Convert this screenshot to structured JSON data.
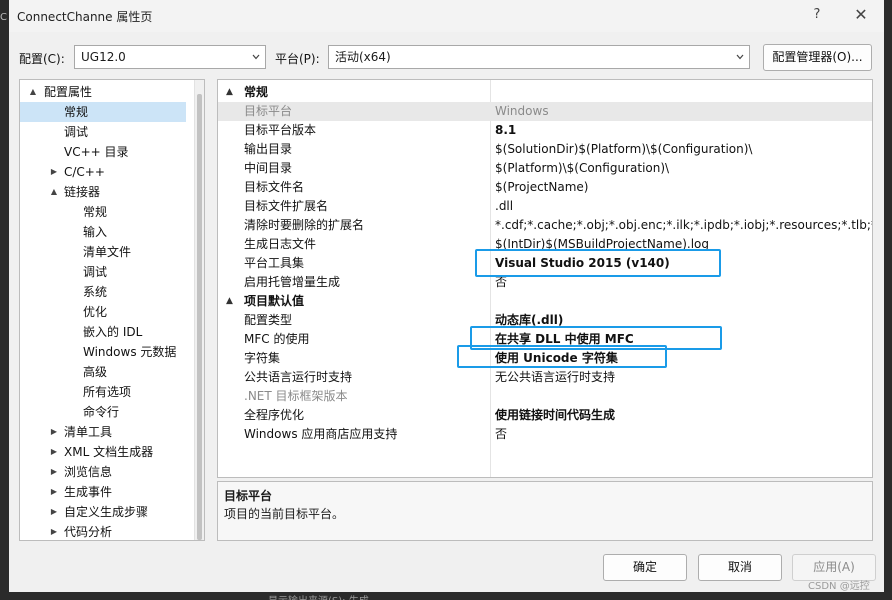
{
  "window": {
    "title": "ConnectChanne 属性页",
    "help_glyph": "?",
    "close_glyph": "✕"
  },
  "toolbar": {
    "config_label": "配置(C):",
    "config_value": "UG12.0",
    "platform_label": "平台(P):",
    "platform_value": "活动(x64)",
    "config_manager_label": "配置管理器(O)..."
  },
  "tree": {
    "items": [
      {
        "label": "配置属性",
        "expand": "▲",
        "depth": 0
      },
      {
        "label": "常规",
        "expand": "",
        "depth": 1,
        "selected": true
      },
      {
        "label": "调试",
        "expand": "",
        "depth": 1
      },
      {
        "label": "VC++ 目录",
        "expand": "",
        "depth": 1
      },
      {
        "label": "C/C++",
        "expand": "▶",
        "depth": 1
      },
      {
        "label": "链接器",
        "expand": "▲",
        "depth": 1
      },
      {
        "label": "常规",
        "expand": "",
        "depth": 2
      },
      {
        "label": "输入",
        "expand": "",
        "depth": 2
      },
      {
        "label": "清单文件",
        "expand": "",
        "depth": 2
      },
      {
        "label": "调试",
        "expand": "",
        "depth": 2
      },
      {
        "label": "系统",
        "expand": "",
        "depth": 2
      },
      {
        "label": "优化",
        "expand": "",
        "depth": 2
      },
      {
        "label": "嵌入的 IDL",
        "expand": "",
        "depth": 2
      },
      {
        "label": "Windows 元数据",
        "expand": "",
        "depth": 2
      },
      {
        "label": "高级",
        "expand": "",
        "depth": 2
      },
      {
        "label": "所有选项",
        "expand": "",
        "depth": 2
      },
      {
        "label": "命令行",
        "expand": "",
        "depth": 2
      },
      {
        "label": "清单工具",
        "expand": "▶",
        "depth": 1
      },
      {
        "label": "XML 文档生成器",
        "expand": "▶",
        "depth": 1
      },
      {
        "label": "浏览信息",
        "expand": "▶",
        "depth": 1
      },
      {
        "label": "生成事件",
        "expand": "▶",
        "depth": 1
      },
      {
        "label": "自定义生成步骤",
        "expand": "▶",
        "depth": 1
      },
      {
        "label": "代码分析",
        "expand": "▶",
        "depth": 1
      }
    ]
  },
  "grid": {
    "sections": [
      {
        "name": "常规",
        "caret": "▲",
        "rows": [
          {
            "name": "目标平台",
            "value": "Windows",
            "disabled": true,
            "selected": true
          },
          {
            "name": "目标平台版本",
            "value": "8.1",
            "bold": true
          },
          {
            "name": "输出目录",
            "value": "$(SolutionDir)$(Platform)\\$(Configuration)\\"
          },
          {
            "name": "中间目录",
            "value": "$(Platform)\\$(Configuration)\\"
          },
          {
            "name": "目标文件名",
            "value": "$(ProjectName)"
          },
          {
            "name": "目标文件扩展名",
            "value": ".dll"
          },
          {
            "name": "清除时要删除的扩展名",
            "value": "*.cdf;*.cache;*.obj;*.obj.enc;*.ilk;*.ipdb;*.iobj;*.resources;*.tlb;*.tli;*.t"
          },
          {
            "name": "生成日志文件",
            "value": "$(IntDir)$(MSBuildProjectName).log"
          },
          {
            "name": "平台工具集",
            "value": "Visual Studio 2015 (v140)",
            "bold": true
          },
          {
            "name": "启用托管增量生成",
            "value": "否"
          }
        ]
      },
      {
        "name": "项目默认值",
        "caret": "▲",
        "rows": [
          {
            "name": "配置类型",
            "value": "动态库(.dll)",
            "bold": true
          },
          {
            "name": "MFC 的使用",
            "value": "在共享 DLL 中使用 MFC",
            "bold": true
          },
          {
            "name": "字符集",
            "value": "使用 Unicode 字符集",
            "bold": true
          },
          {
            "name": "公共语言运行时支持",
            "value": "无公共语言运行时支持"
          },
          {
            "name": ".NET 目标框架版本",
            "value": "",
            "disabled": true
          },
          {
            "name": "全程序优化",
            "value": "使用链接时间代码生成",
            "bold": true
          },
          {
            "name": "Windows 应用商店应用支持",
            "value": "否"
          }
        ]
      }
    ]
  },
  "description": {
    "title": "目标平台",
    "text": "项目的当前目标平台。"
  },
  "footer": {
    "ok_label": "确定",
    "cancel_label": "取消",
    "apply_label": "应用(A)"
  },
  "watermark": "CSDN @远控",
  "background": {
    "cr_text": "C",
    "bottom_text": "显示输出来源(S):  生成"
  },
  "colors": {
    "highlight": "#1a9be8",
    "selection": "#cce4f7"
  }
}
